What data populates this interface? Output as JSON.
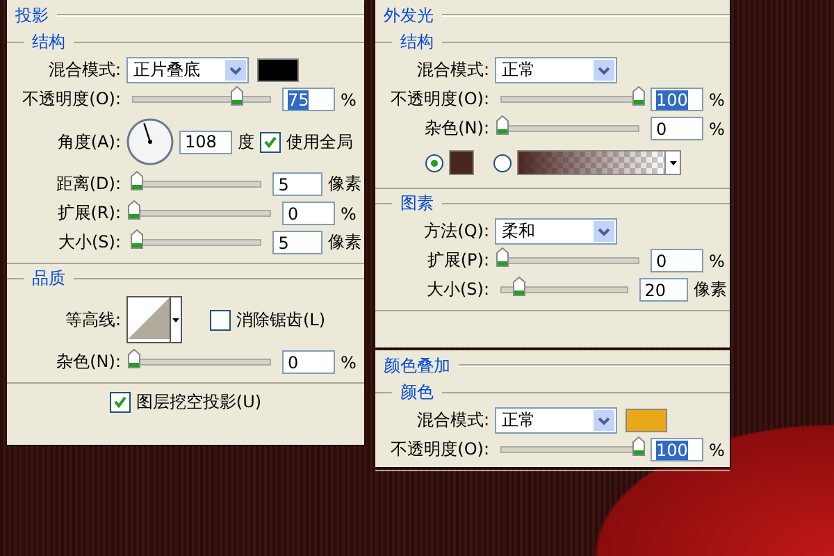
{
  "panels": [
    {
      "title": "投影",
      "sections": [
        {
          "title": "结构",
          "rows": [
            {
              "kind": "select",
              "label": "混合模式:",
              "value": "正片叠底",
              "color": "#000000"
            },
            {
              "kind": "slider",
              "label": "不透明度(O):",
              "level": 0.75,
              "value": "75",
              "text_selected": true,
              "unit": "%"
            },
            {
              "kind": "angle",
              "label": "角度(A):",
              "value": "108",
              "unit": "度",
              "checkbox": {
                "label": "使用全局",
                "checked": true
              }
            },
            {
              "kind": "slider",
              "label": "距离(D):",
              "level": 0.02,
              "value": "5",
              "text_selected": false,
              "unit": "像素"
            },
            {
              "kind": "slider",
              "label": "扩展(R):",
              "level": 0,
              "value": "0",
              "text_selected": false,
              "unit": "%"
            },
            {
              "kind": "slider",
              "label": "大小(S):",
              "level": 0.02,
              "value": "5",
              "text_selected": false,
              "unit": "像素"
            }
          ]
        },
        {
          "title": "品质",
          "rows": [
            {
              "kind": "contour",
              "label": "等高线:",
              "checkbox": {
                "label": "消除锯齿(L)",
                "checked": false
              }
            },
            {
              "kind": "slider",
              "label": "杂色(N):",
              "level": 0,
              "value": "0",
              "text_selected": false,
              "unit": "%"
            }
          ]
        }
      ],
      "footer_checkbox": {
        "label": "图层挖空投影(U)",
        "checked": true
      }
    },
    {
      "title": "外发光",
      "sections": [
        {
          "title": "结构",
          "rows": [
            {
              "kind": "select",
              "label": "混合模式:",
              "value": "正常"
            },
            {
              "kind": "slider",
              "label": "不透明度(O):",
              "level": 1,
              "value": "100",
              "text_selected": true,
              "unit": "%"
            },
            {
              "kind": "slider",
              "label": "杂色(N):",
              "level": 0,
              "value": "0",
              "text_selected": false,
              "unit": "%"
            },
            {
              "kind": "color_choice",
              "options": [
                {
                  "kind": "solid",
                  "selected": true,
                  "color": "#4a2620"
                },
                {
                  "kind": "gradient",
                  "selected": false,
                  "color": "#4a2620"
                }
              ]
            }
          ]
        },
        {
          "title": "图素",
          "rows": [
            {
              "kind": "select",
              "label": "方法(Q):",
              "value": "柔和"
            },
            {
              "kind": "slider",
              "label": "扩展(P):",
              "level": 0,
              "value": "0",
              "text_selected": false,
              "unit": "%"
            },
            {
              "kind": "slider",
              "label": "大小(S):",
              "level": 0.13,
              "value": "20",
              "text_selected": false,
              "unit": "像素"
            }
          ]
        }
      ]
    },
    {
      "title": "颜色叠加",
      "sections": [
        {
          "title": "颜色",
          "rows": [
            {
              "kind": "select",
              "label": "混合模式:",
              "value": "正常",
              "color": "#e8a818"
            },
            {
              "kind": "slider",
              "label": "不透明度(O):",
              "level": 1,
              "value": "100",
              "text_selected": true,
              "unit": "%"
            }
          ]
        }
      ]
    }
  ]
}
